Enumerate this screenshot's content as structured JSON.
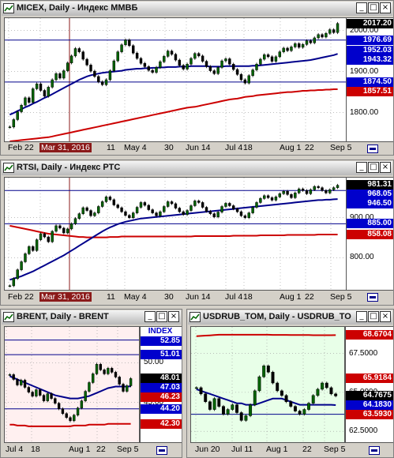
{
  "colors": {
    "upper_bg": "#ffffff",
    "brent_bg": "#fff0f0",
    "usd_bg": "#e8ffe8",
    "price": "#006400",
    "ma_short": "#00008b",
    "ma_long": "#cc0000",
    "grid": "#999999",
    "scale_tag_blue": "#0000cc",
    "scale_tag_red": "#cc0000",
    "scale_tag_black": "#000000",
    "crosshair": "#8b1a1a"
  },
  "icons": {
    "window_icon": "chart-window-icon",
    "minimize": "minimize-icon",
    "maximize": "maximize-icon",
    "close": "close-icon",
    "nav": "scroll-nav-icon"
  },
  "panes": [
    {
      "id": "micex",
      "title": "MICEX, Daily - Индекс ММВБ",
      "buttons": [
        "_",
        "□",
        "×"
      ],
      "scale_ticks": [
        "2000.00",
        "1900.00",
        "1800.00"
      ],
      "scale_tags": [
        {
          "text": "2017.20",
          "type": "black"
        },
        {
          "text": "1976.69",
          "type": "blue"
        },
        {
          "text": "1952.03",
          "type": "blue"
        },
        {
          "text": "1943.32",
          "type": "blue"
        },
        {
          "text": "1874.50",
          "type": "blue"
        },
        {
          "text": "1857.51",
          "type": "red"
        }
      ],
      "x_labels": [
        "Feb 22",
        "Mar 31, 2016",
        "11",
        "May 4",
        "30",
        "Jun 14",
        "Jul 4",
        "18",
        "Aug 1",
        "22",
        "Sep 5"
      ],
      "chart_data": {
        "type": "candlestick",
        "ylim": [
          1730,
          2030
        ],
        "close": [
          1765,
          1783,
          1802,
          1818,
          1836,
          1825,
          1858,
          1870,
          1854,
          1840,
          1862,
          1880,
          1895,
          1884,
          1902,
          1921,
          1938,
          1956,
          1948,
          1930,
          1916,
          1901,
          1888,
          1875,
          1868,
          1880,
          1902,
          1926,
          1948,
          1965,
          1977,
          1963,
          1945,
          1932,
          1920,
          1912,
          1903,
          1898,
          1910,
          1924,
          1937,
          1950,
          1942,
          1928,
          1915,
          1906,
          1918,
          1932,
          1944,
          1938,
          1925,
          1912,
          1902,
          1895,
          1910,
          1926,
          1931,
          1918,
          1905,
          1893,
          1880,
          1872,
          1890,
          1904,
          1918,
          1930,
          1941,
          1936,
          1925,
          1936,
          1948,
          1957,
          1951,
          1960,
          1968,
          1959,
          1966,
          1975,
          1970,
          1982,
          1990,
          1984,
          1993,
          2002,
          1995,
          2017
        ],
        "ma_short": [
          1795,
          1799,
          1804,
          1808,
          1813,
          1817,
          1822,
          1826,
          1831,
          1836,
          1840,
          1845,
          1850,
          1855,
          1860,
          1865,
          1870,
          1875,
          1880,
          1884,
          1888,
          1891,
          1893,
          1895,
          1897,
          1898,
          1899,
          1900,
          1901,
          1902,
          1904,
          1905,
          1906,
          1907,
          1907,
          1908,
          1908,
          1909,
          1909,
          1910,
          1910,
          1911,
          1911,
          1911,
          1912,
          1912,
          1912,
          1913,
          1913,
          1913,
          1913,
          1913,
          1912,
          1912,
          1912,
          1912,
          1913,
          1913,
          1913,
          1913,
          1913,
          1913,
          1913,
          1914,
          1914,
          1915,
          1916,
          1917,
          1918,
          1919,
          1920,
          1921,
          1922,
          1923,
          1924,
          1925,
          1926,
          1927,
          1928,
          1930,
          1932,
          1934,
          1936,
          1938,
          1940,
          1943
        ],
        "ma_long": [
          1730,
          1731,
          1732,
          1733,
          1734,
          1735,
          1736,
          1737,
          1738,
          1739,
          1740,
          1742,
          1744,
          1746,
          1748,
          1750,
          1752,
          1754,
          1756,
          1758,
          1760,
          1762,
          1764,
          1766,
          1768,
          1770,
          1772,
          1774,
          1776,
          1778,
          1780,
          1782,
          1784,
          1786,
          1788,
          1790,
          1792,
          1794,
          1796,
          1798,
          1800,
          1802,
          1804,
          1806,
          1808,
          1810,
          1812,
          1813,
          1814,
          1816,
          1818,
          1820,
          1822,
          1824,
          1826,
          1828,
          1830,
          1832,
          1833,
          1834,
          1836,
          1838,
          1839,
          1840,
          1842,
          1843,
          1844,
          1845,
          1846,
          1847,
          1848,
          1849,
          1850,
          1850,
          1851,
          1852,
          1853,
          1853,
          1854,
          1854,
          1855,
          1855,
          1856,
          1856,
          1857,
          1857
        ],
        "hlines": [
          1976.69,
          1874.5
        ]
      }
    },
    {
      "id": "rtsi",
      "title": "RTSI, Daily - Индекс РТС",
      "buttons": [
        "_",
        "□",
        "×"
      ],
      "scale_ticks": [
        "900.00",
        "800.00"
      ],
      "scale_tags": [
        {
          "text": "981.31",
          "type": "black"
        },
        {
          "text": "968.05",
          "type": "blue"
        },
        {
          "text": "946.50",
          "type": "blue"
        },
        {
          "text": "885.00",
          "type": "blue"
        },
        {
          "text": "858.08",
          "type": "red"
        }
      ],
      "x_labels": [
        "Feb 22",
        "Mar 31, 2016",
        "11",
        "May 4",
        "30",
        "Jun 14",
        "Jul 4",
        "18",
        "Aug 1",
        "22",
        "Sep 5"
      ],
      "chart_data": {
        "type": "candlestick",
        "ylim": [
          720,
          1000
        ],
        "close": [
          730,
          748,
          770,
          790,
          810,
          828,
          818,
          845,
          860,
          852,
          840,
          866,
          880,
          874,
          862,
          872,
          885,
          898,
          910,
          925,
          918,
          905,
          912,
          928,
          940,
          952,
          945,
          932,
          925,
          915,
          906,
          900,
          912,
          926,
          938,
          931,
          920,
          912,
          905,
          915,
          928,
          940,
          935,
          924,
          915,
          908,
          918,
          930,
          942,
          938,
          926,
          916,
          910,
          902,
          914,
          928,
          936,
          930,
          922,
          915,
          905,
          900,
          912,
          926,
          938,
          948,
          955,
          950,
          944,
          952,
          960,
          966,
          958,
          950,
          962,
          972,
          968,
          960,
          970,
          978,
          975,
          968,
          962,
          970,
          975,
          981
        ],
        "ma_short": [
          745,
          748,
          751,
          754,
          758,
          762,
          766,
          771,
          776,
          781,
          786,
          791,
          796,
          801,
          806,
          812,
          818,
          824,
          830,
          836,
          842,
          848,
          854,
          860,
          866,
          871,
          876,
          880,
          884,
          887,
          890,
          892,
          894,
          896,
          898,
          899,
          900,
          901,
          902,
          903,
          904,
          905,
          906,
          907,
          908,
          909,
          910,
          911,
          912,
          913,
          914,
          915,
          916,
          917,
          918,
          919,
          920,
          921,
          922,
          923,
          924,
          925,
          926,
          927,
          928,
          929,
          930,
          931,
          932,
          933,
          934,
          935,
          936,
          937,
          938,
          939,
          940,
          941,
          942,
          943,
          944,
          944,
          945,
          945,
          946,
          946.5
        ],
        "ma_long": [
          880,
          878,
          876,
          874,
          872,
          870,
          868,
          866,
          864,
          862,
          860,
          859,
          858,
          857,
          856,
          855,
          854,
          853,
          852,
          852,
          851,
          851,
          851,
          851,
          851,
          851,
          852,
          852,
          852,
          853,
          853,
          853,
          853,
          853,
          853,
          853,
          853,
          853,
          853,
          853,
          853,
          853,
          853,
          853,
          853,
          853,
          853,
          853,
          854,
          854,
          854,
          854,
          854,
          854,
          854,
          854,
          854,
          854,
          855,
          855,
          855,
          855,
          855,
          855,
          855,
          856,
          856,
          856,
          856,
          856,
          856,
          856,
          857,
          857,
          857,
          857,
          857,
          857,
          857,
          857,
          858,
          858,
          858,
          858,
          858,
          858
        ],
        "hlines": [
          968.05,
          885.0
        ]
      }
    },
    {
      "id": "brent",
      "title": "BRENT, Daily - BRENT",
      "buttons": [
        "_",
        "□",
        "×"
      ],
      "scale_ticks": [
        "50.00",
        "45.00"
      ],
      "scale_tags": [
        {
          "text": "INDEX",
          "type": "white"
        },
        {
          "text": "52.85",
          "type": "blue"
        },
        {
          "text": "51.01",
          "type": "blue"
        },
        {
          "text": "48.01",
          "type": "black"
        },
        {
          "text": "47.03",
          "type": "blue"
        },
        {
          "text": "46.23",
          "type": "red"
        },
        {
          "text": "44.20",
          "type": "blue"
        },
        {
          "text": "42.30",
          "type": "red"
        }
      ],
      "x_labels": [
        "Jul 4",
        "18",
        "Aug 1",
        "22",
        "Sep 5"
      ],
      "chart_data": {
        "type": "candlestick",
        "ylim": [
          40,
          54.5
        ],
        "close": [
          48.5,
          47.9,
          47.2,
          47.8,
          46.9,
          46.3,
          45.8,
          46.6,
          45.9,
          45.2,
          46.1,
          45.5,
          44.9,
          44.2,
          43.6,
          43.1,
          42.7,
          43.4,
          44.3,
          45.2,
          46.4,
          47.5,
          48.6,
          49.8,
          49.1,
          48.6,
          49.3,
          48.8,
          48.2,
          47.3,
          46.4,
          47.1,
          48.0
        ],
        "ma_short": [
          48.3,
          48.1,
          47.9,
          47.7,
          47.5,
          47.3,
          47.1,
          46.9,
          46.7,
          46.5,
          46.3,
          46.1,
          45.9,
          45.8,
          45.7,
          45.6,
          45.5,
          45.5,
          45.5,
          45.6,
          45.7,
          45.8,
          46.0,
          46.2,
          46.4,
          46.6,
          46.8,
          46.9,
          47.0,
          47.0,
          47.0,
          47.0,
          47.03
        ],
        "ma_long": [
          42.2,
          42.2,
          42.1,
          42.1,
          42.1,
          42.0,
          42.0,
          42.0,
          42.0,
          42.0,
          42.0,
          42.0,
          42.0,
          42.0,
          42.0,
          42.0,
          42.0,
          42.1,
          42.1,
          42.1,
          42.1,
          42.2,
          42.2,
          42.2,
          42.2,
          42.2,
          42.3,
          42.3,
          42.3,
          42.3,
          42.3,
          42.3,
          42.3
        ],
        "hlines": [
          52.85,
          51.01,
          44.2
        ]
      }
    },
    {
      "id": "usdrub",
      "title": "USDRUB_TOM, Daily - USDRUB_TOM",
      "buttons": [
        "_",
        "□",
        "×"
      ],
      "scale_ticks": [
        "67.5000",
        "65.0000",
        "62.5000"
      ],
      "scale_tags": [
        {
          "text": "68.6704",
          "type": "red"
        },
        {
          "text": "65.9184",
          "type": "red"
        },
        {
          "text": "64.7675",
          "type": "black"
        },
        {
          "text": "64.1830",
          "type": "blue"
        },
        {
          "text": "63.5930",
          "type": "red"
        }
      ],
      "x_labels": [
        "Jun 20",
        "Jul 11",
        "Aug 1",
        "22",
        "Sep 5"
      ],
      "chart_data": {
        "type": "candlestick",
        "ylim": [
          61.8,
          69.2
        ],
        "close": [
          65.3,
          64.9,
          64.4,
          63.9,
          64.6,
          64.1,
          63.6,
          63.9,
          64.2,
          63.7,
          63.2,
          63.5,
          64.2,
          65.1,
          66.0,
          66.7,
          66.3,
          65.6,
          65.1,
          64.8,
          64.4,
          64.1,
          63.8,
          63.6,
          63.9,
          64.3,
          64.8,
          65.2,
          65.6,
          65.3,
          64.9,
          64.77
        ],
        "ma_short": [
          65.2,
          65.1,
          65.0,
          64.9,
          64.8,
          64.7,
          64.6,
          64.5,
          64.4,
          64.3,
          64.3,
          64.2,
          64.2,
          64.2,
          64.3,
          64.4,
          64.5,
          64.6,
          64.6,
          64.6,
          64.5,
          64.4,
          64.3,
          64.2,
          64.2,
          64.2,
          64.2,
          64.2,
          64.2,
          64.2,
          64.2,
          64.18
        ],
        "ma_long": [
          68.6,
          68.62,
          68.64,
          68.66,
          68.68,
          68.7,
          68.7,
          68.7,
          68.7,
          68.7,
          68.7,
          68.7,
          68.7,
          68.7,
          68.7,
          68.7,
          68.7,
          68.69,
          68.69,
          68.69,
          68.69,
          68.68,
          68.68,
          68.68,
          68.68,
          68.68,
          68.67,
          68.67,
          68.67,
          68.67,
          68.67,
          68.6704
        ],
        "hlines": [
          63.593
        ]
      }
    }
  ]
}
